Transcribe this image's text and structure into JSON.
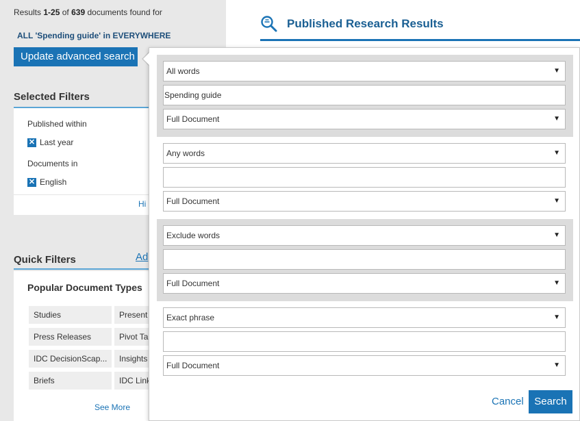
{
  "results": {
    "prefix": "Results",
    "range": "1-25",
    "of_word": "of",
    "total": "639",
    "suffix": "documents found for",
    "query": "ALL 'Spending guide' in EVERYWHERE"
  },
  "update_button": "Update advanced search",
  "selected_filters": {
    "title": "Selected Filters",
    "groups": [
      {
        "label": "Published within",
        "chip": "Last year"
      },
      {
        "label": "Documents in",
        "chip": "English"
      }
    ],
    "hide_link": "Hi"
  },
  "quick_filters": {
    "title": "Quick Filters",
    "add_link": "Ad",
    "popular_title": "Popular Document Types",
    "doc_types": [
      [
        "Studies",
        "Present"
      ],
      [
        "Press Releases",
        "Pivot Ta"
      ],
      [
        "IDC DecisionScap...",
        "Insights"
      ],
      [
        "Briefs",
        "IDC Link"
      ]
    ],
    "see_more": "See More"
  },
  "header": {
    "title": "Published Research Results",
    "icon": "search-icon"
  },
  "advanced_search": {
    "groups": [
      {
        "mode": "All words",
        "text": "Spending guide",
        "scope": "Full Document"
      },
      {
        "mode": "Any words",
        "text": "",
        "scope": "Full Document"
      },
      {
        "mode": "Exclude words",
        "text": "",
        "scope": "Full Document"
      },
      {
        "mode": "Exact phrase",
        "text": "",
        "scope": "Full Document"
      }
    ],
    "cancel": "Cancel",
    "search": "Search"
  },
  "colors": {
    "accent": "#1a73b5",
    "panel_bg": "#e8e8e8",
    "group_bg": "#dcdcdc"
  }
}
